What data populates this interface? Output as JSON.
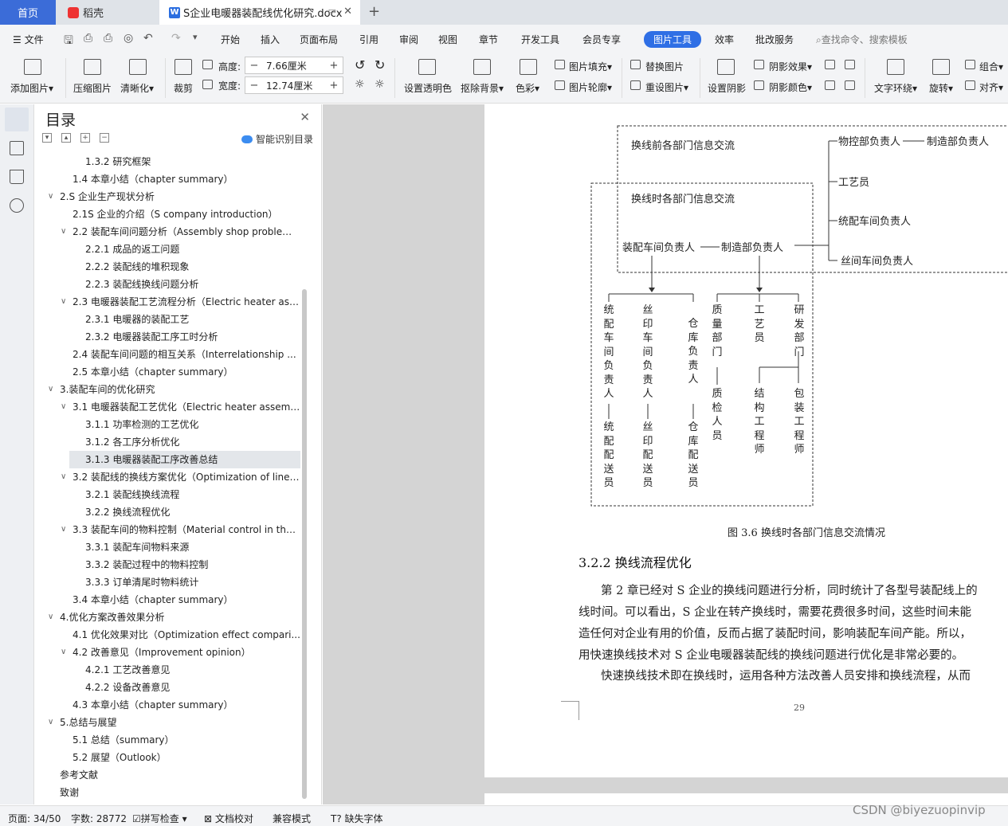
{
  "tabs": {
    "home": "首页",
    "daoke": "稻壳",
    "doc": "S企业电暖器装配线优化研究.docx"
  },
  "menu": {
    "file": "文件",
    "items": [
      "开始",
      "插入",
      "页面布局",
      "引用",
      "审阅",
      "视图",
      "章节",
      "开发工具",
      "会员专享"
    ],
    "active": "图片工具",
    "after": [
      "效率",
      "批改服务"
    ],
    "search": "查找命令、搜索模板"
  },
  "ribbon": {
    "add_pic": "添加图片",
    "compress": "压缩图片",
    "clarify": "清晰化",
    "crop": "裁剪",
    "height_label": "高度:",
    "height_val": "7.66厘米",
    "width_label": "宽度:",
    "width_val": "12.74厘米",
    "transparent": "设置透明色",
    "remove_bg": "抠除背景",
    "color": "色彩",
    "fill": "图片填充",
    "outline": "图片轮廓",
    "replace": "替换图片",
    "reset": "重设图片",
    "shadow": "设置阴影",
    "shadow_effect": "阴影效果",
    "shadow_color": "阴影颜色",
    "wrap": "文字环绕",
    "rotate": "旋转",
    "group": "组合",
    "align": "对齐"
  },
  "toc": {
    "title": "目录",
    "smart": "智能识别目录",
    "items": [
      {
        "t": "1.3.2 研究框架",
        "lv": 3
      },
      {
        "t": "1.4 本章小结（chapter summary）",
        "lv": 2
      },
      {
        "t": "2.S 企业生产现状分析",
        "lv": 1,
        "exp": true
      },
      {
        "t": "2.1S 企业的介绍（S company introduction）",
        "lv": 2
      },
      {
        "t": "2.2 装配车间问题分析（Assembly shop problem ...",
        "lv": 2,
        "exp": true
      },
      {
        "t": "2.2.1 成品的返工问题",
        "lv": 3
      },
      {
        "t": "2.2.2 装配线的堆积现象",
        "lv": 3
      },
      {
        "t": "2.2.3 装配线换线问题分析",
        "lv": 3
      },
      {
        "t": "2.3 电暖器装配工艺流程分析（Electric heater ass...",
        "lv": 2,
        "exp": true
      },
      {
        "t": "2.3.1 电暖器的装配工艺",
        "lv": 3
      },
      {
        "t": "2.3.2 电暖器装配工序工时分析",
        "lv": 3
      },
      {
        "t": "2.4 装配车间问题的相互关系（Interrelationship ...",
        "lv": 2
      },
      {
        "t": "2.5 本章小结（chapter summary）",
        "lv": 2
      },
      {
        "t": "3.装配车间的优化研究",
        "lv": 1,
        "exp": true
      },
      {
        "t": "3.1 电暖器装配工艺优化（Electric heater assemb...",
        "lv": 2,
        "exp": true
      },
      {
        "t": "3.1.1 功率检测的工艺优化",
        "lv": 3
      },
      {
        "t": "3.1.2 各工序分析优化",
        "lv": 3
      },
      {
        "t": "3.1.3 电暖器装配工序改善总结",
        "lv": 3,
        "sel": true
      },
      {
        "t": "3.2 装配线的换线方案优化（Optimization of line ...",
        "lv": 2,
        "exp": true
      },
      {
        "t": "3.2.1 装配线换线流程",
        "lv": 3
      },
      {
        "t": "3.2.2 换线流程优化",
        "lv": 3
      },
      {
        "t": "3.3 装配车间的物料控制（Material control in the ...",
        "lv": 2,
        "exp": true
      },
      {
        "t": "3.3.1 装配车间物料来源",
        "lv": 3
      },
      {
        "t": "3.3.2 装配过程中的物料控制",
        "lv": 3
      },
      {
        "t": "3.3.3 订单清尾时物料统计",
        "lv": 3
      },
      {
        "t": "3.4 本章小结（chapter summary）",
        "lv": 2
      },
      {
        "t": "4.优化方案改善效果分析",
        "lv": 1,
        "exp": true
      },
      {
        "t": "4.1 优化效果对比（Optimization effect compari...",
        "lv": 2
      },
      {
        "t": "4.2 改善意见（Improvement opinion）",
        "lv": 2,
        "exp": true
      },
      {
        "t": "4.2.1 工艺改善意见",
        "lv": 3
      },
      {
        "t": "4.2.2 设备改善意见",
        "lv": 3
      },
      {
        "t": "4.3 本章小结（chapter summary）",
        "lv": 2
      },
      {
        "t": "5.总结与展望",
        "lv": 1,
        "exp": true
      },
      {
        "t": "5.1 总结（summary）",
        "lv": 2
      },
      {
        "t": "5.2 展望（Outlook）",
        "lv": 2
      },
      {
        "t": "参考文献",
        "lv": 1
      },
      {
        "t": "致谢",
        "lv": 1
      }
    ]
  },
  "diagram": {
    "before": "换线前各部门信息交流",
    "during": "换线时各部门信息交流",
    "assembly_head": "装配车间负责人",
    "mfg_head": "制造部负责人",
    "material_head": "物控部负责人",
    "mfg_head2": "制造部负责人",
    "tech": "工艺员",
    "unify_head": "统配车间负责人",
    "silk_head": "丝间车间负责人",
    "col1": "统配车间负责人",
    "col1b": "统配配送员",
    "col2": "丝印车间负责人",
    "col2b": "丝印配送员",
    "col3": "仓库负责人",
    "col3b": "仓库配送员",
    "col4": "质量部门",
    "col4b": "质检人员",
    "col5": "工艺员",
    "col6": "研发部门",
    "col7": "结构工程师",
    "col8": "包装工程师"
  },
  "doc": {
    "caption": "图 3.6 换线时各部门信息交流情况",
    "heading": "3.2.2 换线流程优化",
    "p1": "第 2 章已经对 S 企业的换线问题进行分析，同时统计了各型号装配线上的",
    "p2": "线时间。可以看出，S 企业在转产换线时，需要花费很多时间，这些时间未能",
    "p3": "造任何对企业有用的价值，反而占据了装配时间，影响装配车间产能。所以，",
    "p4": "用快速换线技术对 S 企业电暖器装配线的换线问题进行优化是非常必要的。",
    "p5": "快速换线技术即在换线时，运用各种方法改善人员安排和换线流程，从而",
    "page_no": "29"
  },
  "status": {
    "page": "页面: 34/50",
    "words": "字数: 28772",
    "spell": "拼写检查",
    "proof": "文档校对",
    "compat": "兼容模式",
    "font": "缺失字体"
  },
  "watermark": "CSDN @biyezuopinvip"
}
